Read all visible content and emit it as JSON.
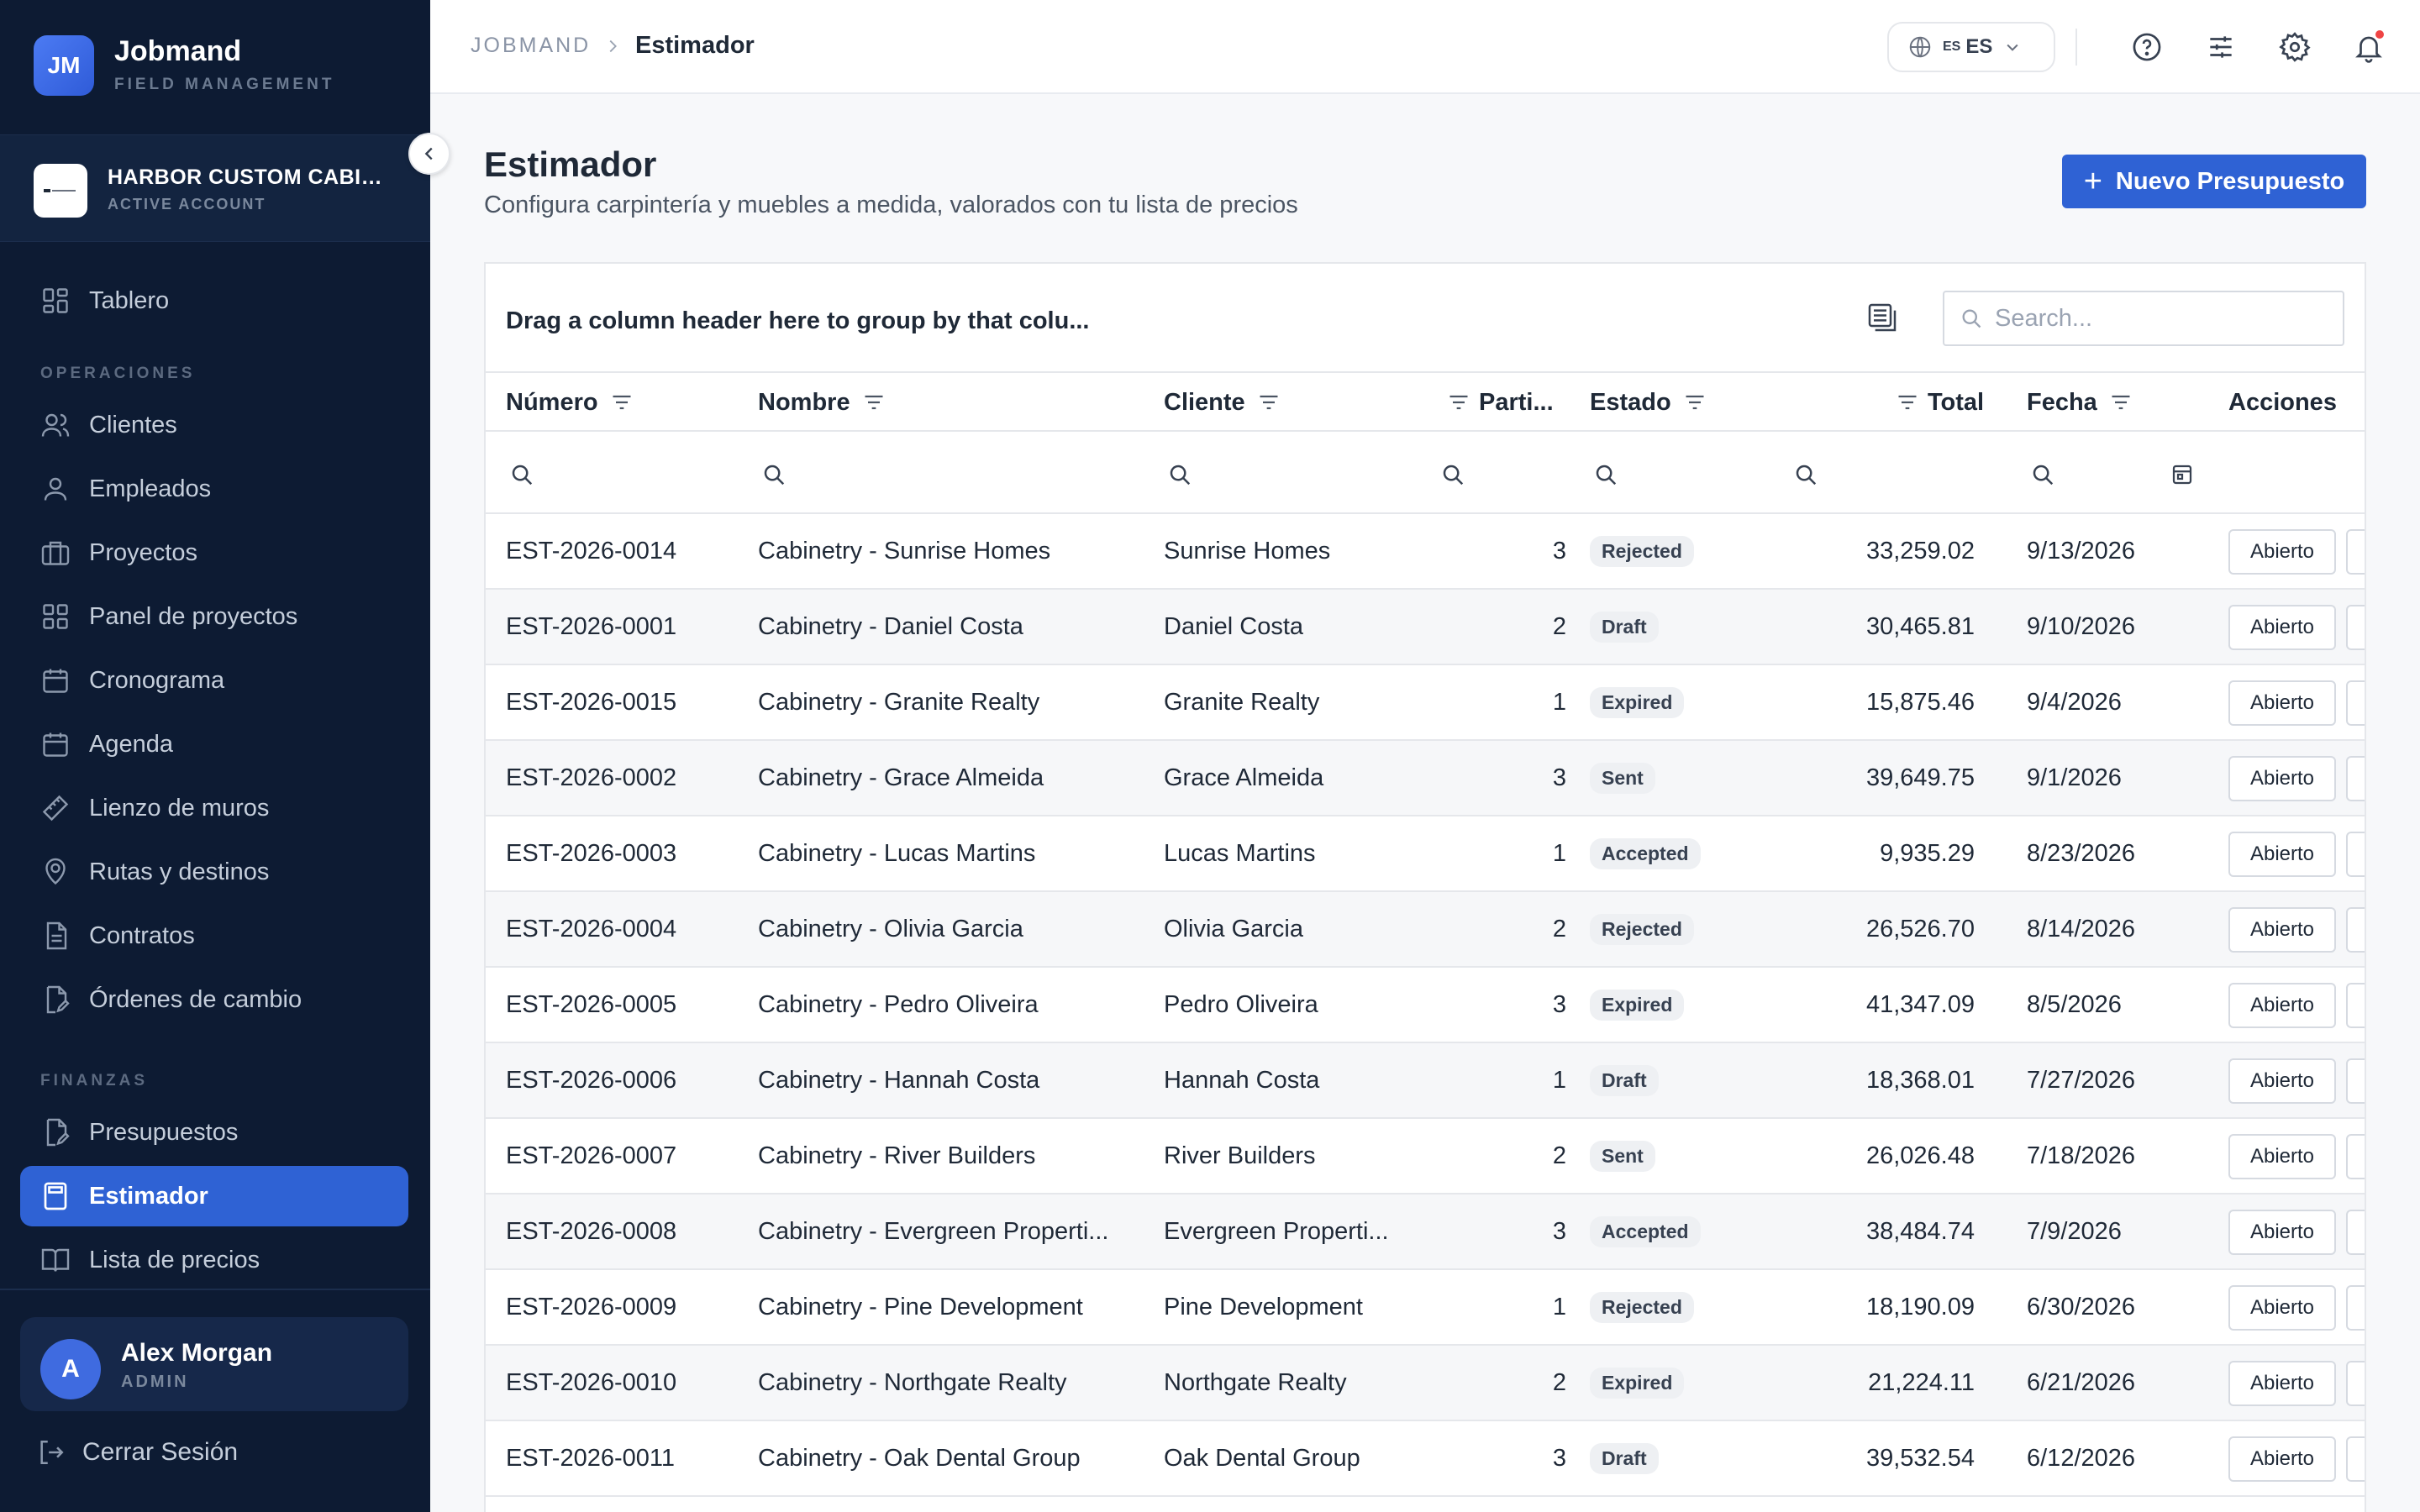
{
  "brand": {
    "initials": "JM",
    "name": "Jobmand",
    "subtitle": "FIELD MANAGEMENT"
  },
  "account": {
    "name": "HARBOR CUSTOM CABINETRY",
    "status": "ACTIVE ACCOUNT"
  },
  "sidebar": {
    "top_item": {
      "label": "Tablero",
      "icon": "dashboard-icon"
    },
    "section_ops": "OPERACIONES",
    "ops_items": [
      {
        "label": "Clientes",
        "icon": "users-icon"
      },
      {
        "label": "Empleados",
        "icon": "user-icon"
      },
      {
        "label": "Proyectos",
        "icon": "briefcase-icon"
      },
      {
        "label": "Panel de proyectos",
        "icon": "grid-icon"
      },
      {
        "label": "Cronograma",
        "icon": "calendar-icon"
      },
      {
        "label": "Agenda",
        "icon": "calendar-icon"
      },
      {
        "label": "Lienzo de muros",
        "icon": "ruler-icon"
      },
      {
        "label": "Rutas y destinos",
        "icon": "route-icon"
      },
      {
        "label": "Contratos",
        "icon": "document-icon"
      },
      {
        "label": "Órdenes de cambio",
        "icon": "document-edit-icon"
      }
    ],
    "section_fin": "FINANZAS",
    "fin_items": [
      {
        "label": "Presupuestos",
        "icon": "document-edit-icon"
      },
      {
        "label": "Estimador",
        "icon": "calculator-icon",
        "active": true
      },
      {
        "label": "Lista de precios",
        "icon": "book-icon"
      }
    ]
  },
  "user": {
    "initial": "A",
    "name": "Alex Morgan",
    "role": "ADMIN"
  },
  "logout_label": "Cerrar Sesión",
  "breadcrumb": {
    "root": "JOBMAND",
    "current": "Estimador"
  },
  "language": {
    "flag": "ES",
    "code": "ES"
  },
  "page": {
    "title": "Estimador",
    "subtitle": "Configura carpintería y muebles a medida, valorados con tu lista de precios",
    "new_button": "Nuevo Presupuesto"
  },
  "grid": {
    "group_panel_text": "Drag a column header here to group by that colu...",
    "search_placeholder": "Search...",
    "columns": {
      "numero": "Número",
      "nombre": "Nombre",
      "cliente": "Cliente",
      "partidas": "Parti...",
      "estado": "Estado",
      "total": "Total",
      "fecha": "Fecha",
      "acciones": "Acciones"
    },
    "action_label": "Abierto",
    "rows": [
      {
        "numero": "EST-2026-0014",
        "nombre": "Cabinetry - Sunrise Homes",
        "cliente": "Sunrise Homes",
        "partidas": "3",
        "estado": "Rejected",
        "total": "33,259.02",
        "fecha": "9/13/2026"
      },
      {
        "numero": "EST-2026-0001",
        "nombre": "Cabinetry - Daniel Costa",
        "cliente": "Daniel Costa",
        "partidas": "2",
        "estado": "Draft",
        "total": "30,465.81",
        "fecha": "9/10/2026"
      },
      {
        "numero": "EST-2026-0015",
        "nombre": "Cabinetry - Granite Realty",
        "cliente": "Granite Realty",
        "partidas": "1",
        "estado": "Expired",
        "total": "15,875.46",
        "fecha": "9/4/2026"
      },
      {
        "numero": "EST-2026-0002",
        "nombre": "Cabinetry - Grace Almeida",
        "cliente": "Grace Almeida",
        "partidas": "3",
        "estado": "Sent",
        "total": "39,649.75",
        "fecha": "9/1/2026"
      },
      {
        "numero": "EST-2026-0003",
        "nombre": "Cabinetry - Lucas Martins",
        "cliente": "Lucas Martins",
        "partidas": "1",
        "estado": "Accepted",
        "total": "9,935.29",
        "fecha": "8/23/2026"
      },
      {
        "numero": "EST-2026-0004",
        "nombre": "Cabinetry - Olivia Garcia",
        "cliente": "Olivia Garcia",
        "partidas": "2",
        "estado": "Rejected",
        "total": "26,526.70",
        "fecha": "8/14/2026"
      },
      {
        "numero": "EST-2026-0005",
        "nombre": "Cabinetry - Pedro Oliveira",
        "cliente": "Pedro Oliveira",
        "partidas": "3",
        "estado": "Expired",
        "total": "41,347.09",
        "fecha": "8/5/2026"
      },
      {
        "numero": "EST-2026-0006",
        "nombre": "Cabinetry - Hannah Costa",
        "cliente": "Hannah Costa",
        "partidas": "1",
        "estado": "Draft",
        "total": "18,368.01",
        "fecha": "7/27/2026"
      },
      {
        "numero": "EST-2026-0007",
        "nombre": "Cabinetry - River Builders",
        "cliente": "River Builders",
        "partidas": "2",
        "estado": "Sent",
        "total": "26,026.48",
        "fecha": "7/18/2026"
      },
      {
        "numero": "EST-2026-0008",
        "nombre": "Cabinetry - Evergreen Properti...",
        "cliente": "Evergreen Properti...",
        "partidas": "3",
        "estado": "Accepted",
        "total": "38,484.74",
        "fecha": "7/9/2026"
      },
      {
        "numero": "EST-2026-0009",
        "nombre": "Cabinetry - Pine Development",
        "cliente": "Pine Development",
        "partidas": "1",
        "estado": "Rejected",
        "total": "18,190.09",
        "fecha": "6/30/2026"
      },
      {
        "numero": "EST-2026-0010",
        "nombre": "Cabinetry - Northgate Realty",
        "cliente": "Northgate Realty",
        "partidas": "2",
        "estado": "Expired",
        "total": "21,224.11",
        "fecha": "6/21/2026"
      },
      {
        "numero": "EST-2026-0011",
        "nombre": "Cabinetry - Oak Dental Group",
        "cliente": "Oak Dental Group",
        "partidas": "3",
        "estado": "Draft",
        "total": "39,532.54",
        "fecha": "6/12/2026"
      }
    ]
  },
  "colors": {
    "sidebar_bg": "#0d1b33",
    "accent": "#2f62d4",
    "notification": "#ef4444"
  }
}
